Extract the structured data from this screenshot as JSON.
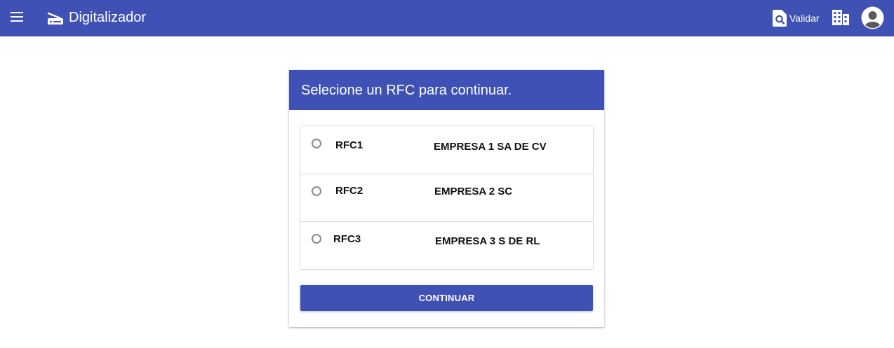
{
  "header": {
    "title": "Digitalizador",
    "menu_icon": "menu-icon",
    "brand_icon": "scanner-icon",
    "validar_label": "Validar",
    "validar_icon": "search-document-icon",
    "building_icon": "building-icon",
    "avatar_icon": "account-circle-icon",
    "background_color": "#3f51b5"
  },
  "card": {
    "title": "Selecione un RFC para continuar.",
    "options": [
      {
        "rfc": "RFC1",
        "name": "EMPRESA 1 SA DE CV",
        "selected": false
      },
      {
        "rfc": "RFC2",
        "name": "EMPRESA 2 SC",
        "selected": false
      },
      {
        "rfc": "RFC3",
        "name": "EMPRESA 3 S DE RL",
        "selected": false
      }
    ],
    "continue_label": "CONTINUAR",
    "accent_color": "#3f51b5"
  }
}
